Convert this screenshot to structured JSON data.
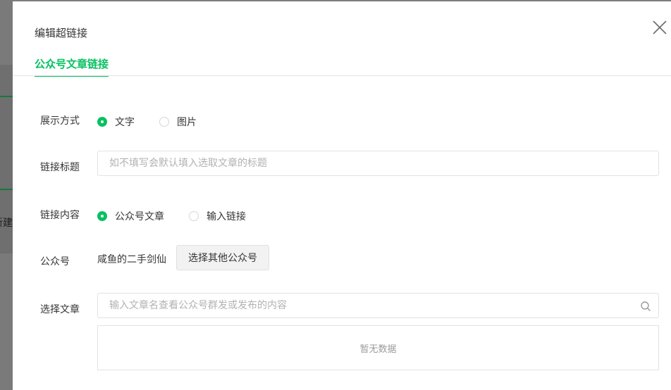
{
  "background": {
    "partial_text": "新建"
  },
  "dialog": {
    "title": "编辑超链接",
    "tab": "公众号文章链接",
    "display_mode": {
      "label": "展示方式",
      "options": [
        "文字",
        "图片"
      ],
      "selected": "文字"
    },
    "link_title": {
      "label": "链接标题",
      "placeholder": "如不填写会默认填入选取文章的标题",
      "value": ""
    },
    "link_content": {
      "label": "链接内容",
      "options": [
        "公众号文章",
        "输入链接"
      ],
      "selected": "公众号文章"
    },
    "account": {
      "label": "公众号",
      "name": "咸鱼的二手剑仙",
      "button": "选择其他公众号"
    },
    "article": {
      "label": "选择文章",
      "placeholder": "输入文章名查看公众号群发或发布的内容",
      "value": "",
      "empty_text": "暂无数据"
    }
  },
  "colors": {
    "accent": "#07c160",
    "overlay": "#7d7d7d"
  },
  "icons": {
    "close": "close-icon",
    "search": "search-icon"
  }
}
